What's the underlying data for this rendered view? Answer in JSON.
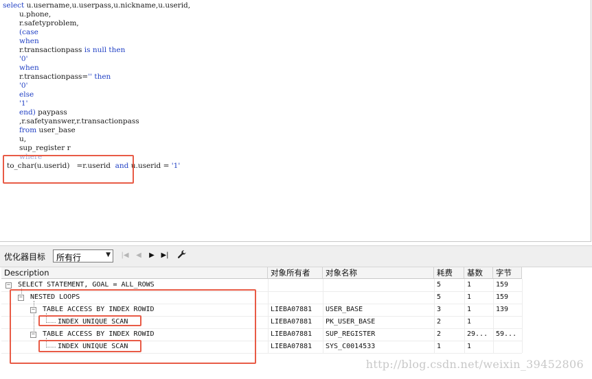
{
  "editor": {
    "lines": [
      "select u.username,u.userpass,u.nickname,u.userid,",
      "u.phone,",
      "r.safetyproblem,",
      "(case",
      "when",
      "r.transactionpass is null then",
      "'0'",
      "when",
      "r.transactionpass='' then",
      "'0'",
      "else",
      "'1'",
      "end) paypass",
      ",r.safetyanswer,r.transactionpass",
      "from user_base",
      "u,",
      "sup_register r",
      "where",
      "to_char(u.userid)   =r.userid  and u.userid = '1'"
    ]
  },
  "toolbar": {
    "label": "优化器目标",
    "goal_value": "所有行",
    "first_icon": "first-record-icon",
    "prev_icon": "previous-record-icon",
    "next_icon": "next-record-icon",
    "last_icon": "last-record-icon",
    "settings_icon": "wrench-icon"
  },
  "grid": {
    "headers": [
      "Description",
      "对象所有者",
      "对象名称",
      "耗费",
      "基数",
      "字节"
    ],
    "rows": [
      {
        "desc": "SELECT STATEMENT, GOAL = ALL_ROWS",
        "owner": "",
        "object": "",
        "cost": "5",
        "card": "1",
        "bytes": "159"
      },
      {
        "desc": "NESTED LOOPS",
        "owner": "",
        "object": "",
        "cost": "5",
        "card": "1",
        "bytes": "159"
      },
      {
        "desc": "TABLE ACCESS BY INDEX ROWID",
        "owner": "LIEBA07881",
        "object": "USER_BASE",
        "cost": "3",
        "card": "1",
        "bytes": "139"
      },
      {
        "desc": "INDEX UNIQUE SCAN",
        "owner": "LIEBA07881",
        "object": "PK_USER_BASE",
        "cost": "2",
        "card": "1",
        "bytes": ""
      },
      {
        "desc": "TABLE ACCESS BY INDEX ROWID",
        "owner": "LIEBA07881",
        "object": "SUP_REGISTER",
        "cost": "2",
        "card": "29...",
        "bytes": "59..."
      },
      {
        "desc": "INDEX UNIQUE SCAN",
        "owner": "LIEBA07881",
        "object": "SYS_C0014533",
        "cost": "1",
        "card": "1",
        "bytes": ""
      }
    ]
  },
  "watermark": "http://blog.csdn.net/weixin_39452806"
}
